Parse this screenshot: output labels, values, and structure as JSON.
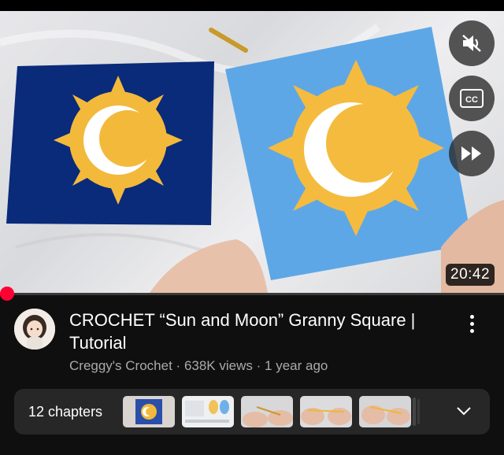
{
  "video": {
    "duration": "20:42",
    "progress_fraction": 0.0,
    "controls": {
      "mute_icon": "speaker-muted-icon",
      "captions_icon": "closed-captions-icon",
      "skip_icon": "fast-forward-icon",
      "captions_label": "CC"
    }
  },
  "details": {
    "title": "CROCHET “Sun and Moon” Granny Square | Tutorial",
    "channel": "Creggy's Crochet",
    "views": "638K views",
    "age": "1 year ago",
    "separator": "·",
    "more_icon": "more-vertical-icon"
  },
  "chapters": {
    "label": "12 chapters",
    "expand_icon": "chevron-down-icon"
  },
  "colors": {
    "background": "#0f0f0f",
    "progress_accent": "#ff0033",
    "meta_text": "#aaaaaa",
    "chapters_bg": "#272727"
  }
}
